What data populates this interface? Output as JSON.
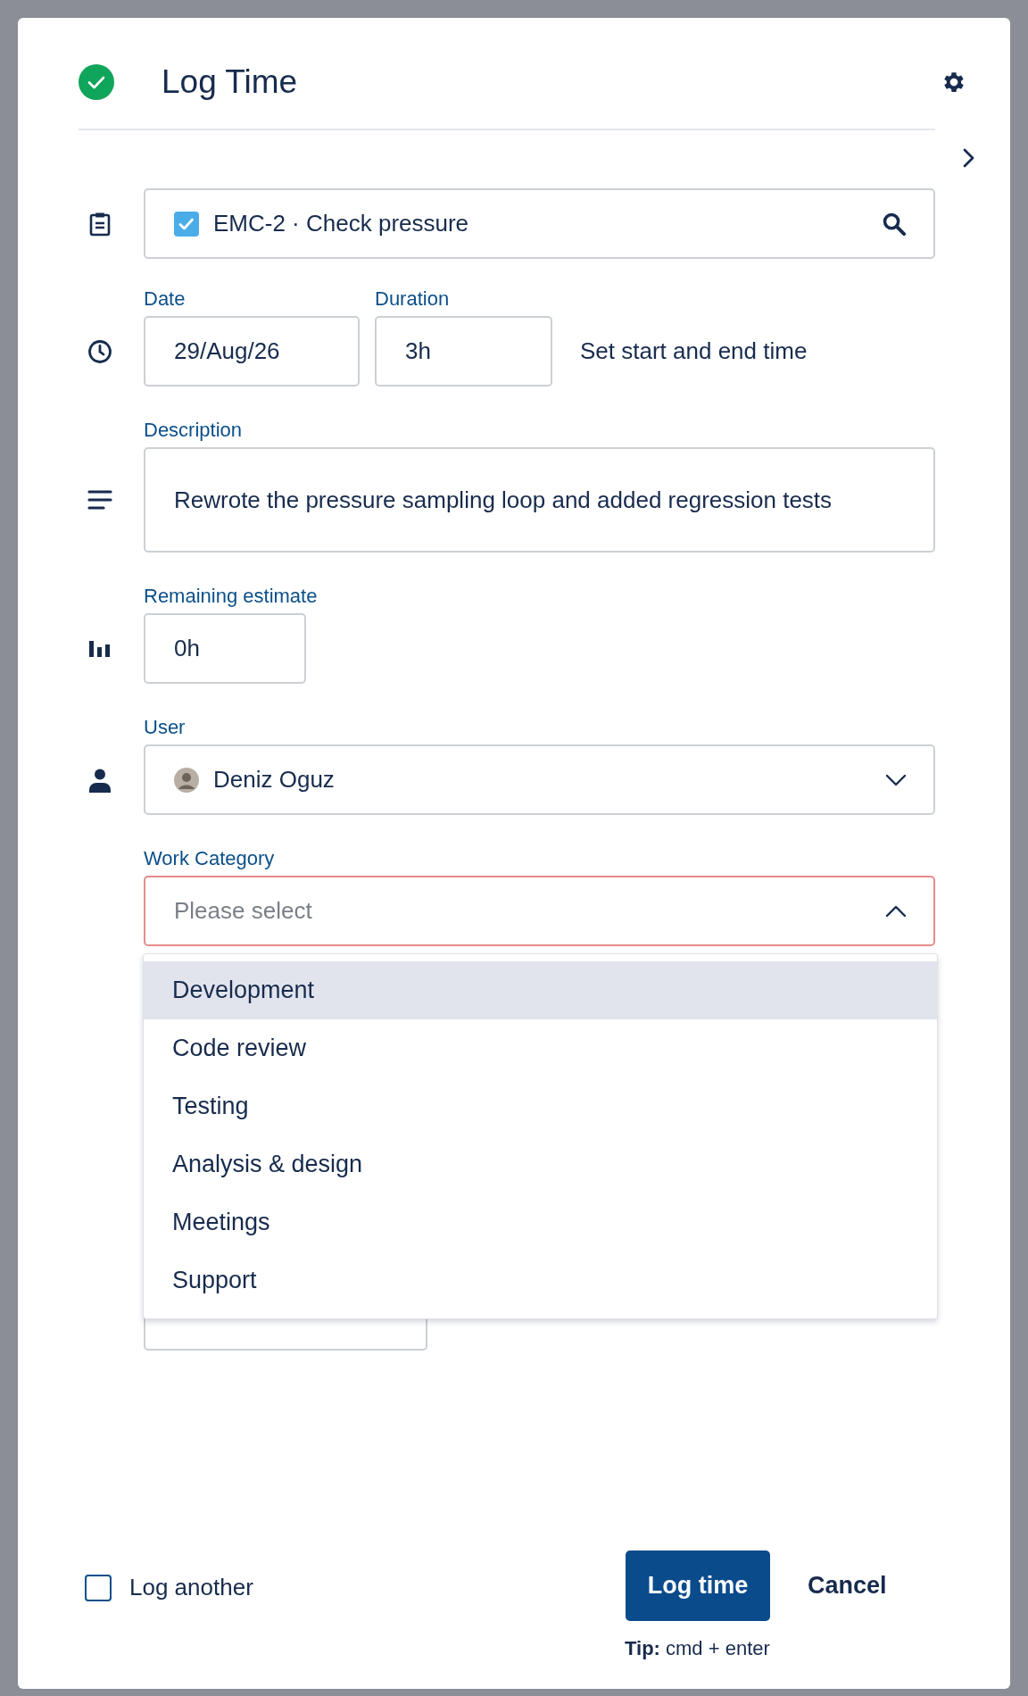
{
  "dialog": {
    "title": "Log Time"
  },
  "issue": {
    "value": "EMC-2 · Check pressure"
  },
  "date": {
    "label": "Date",
    "value": "29/Aug/26"
  },
  "duration": {
    "label": "Duration",
    "value": "3h"
  },
  "time_range_link": "Set start and end time",
  "description": {
    "label": "Description",
    "value": "Rewrote the pressure sampling loop and added regression tests"
  },
  "remaining_estimate": {
    "label": "Remaining estimate",
    "value": "0h"
  },
  "user": {
    "label": "User",
    "value": "Deniz Oguz"
  },
  "work_category": {
    "label": "Work Category",
    "placeholder": "Please select",
    "expanded": true,
    "invalid": true,
    "options": [
      {
        "label": "Development",
        "selected": true
      },
      {
        "label": "Code review",
        "selected": false
      },
      {
        "label": "Testing",
        "selected": false
      },
      {
        "label": "Analysis & design",
        "selected": false
      },
      {
        "label": "Meetings",
        "selected": false
      },
      {
        "label": "Support",
        "selected": false
      }
    ]
  },
  "log_another": {
    "label": "Log another",
    "checked": false
  },
  "buttons": [
    {
      "label": "Log time",
      "kind": "primary"
    },
    {
      "label": "Cancel",
      "kind": "subtle"
    }
  ],
  "tip": "**Tip:** cmd + enter"
}
